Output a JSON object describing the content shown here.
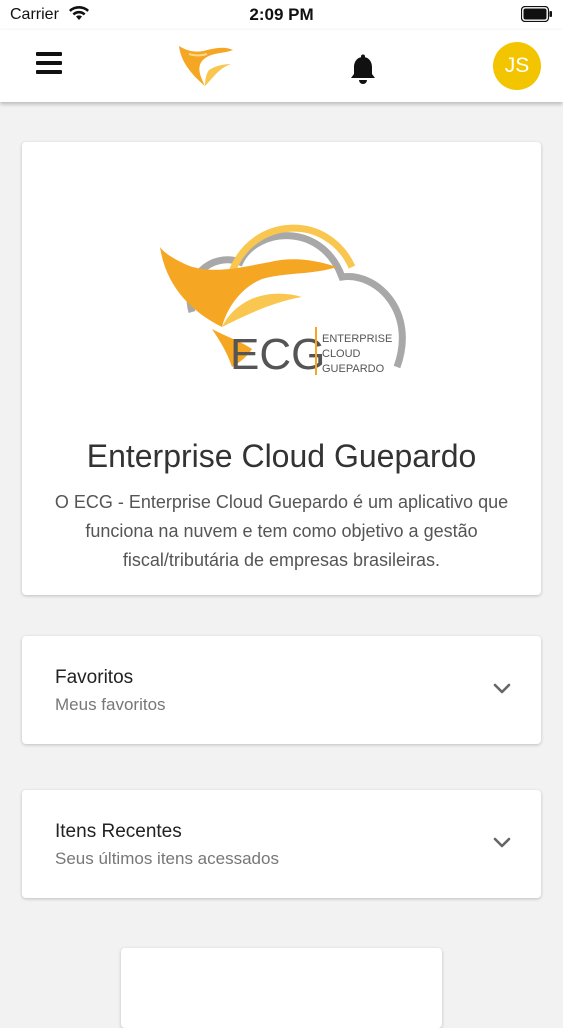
{
  "status_bar": {
    "carrier": "Carrier",
    "time": "2:09 PM"
  },
  "header": {
    "menu_icon": "hamburger-menu-icon",
    "logo_icon": "cheetah-logo-icon",
    "notification_icon": "bell-icon",
    "avatar_initials": "JS",
    "avatar_color": "#f2c500"
  },
  "hero": {
    "logo_text": {
      "abbr": "ECG",
      "line1": "ENTERPRISE",
      "line2": "CLOUD",
      "line3": "GUEPARDO"
    },
    "title": "Enterprise Cloud Guepardo",
    "description": "O ECG - Enterprise Cloud Guepardo é um aplicativo que funciona na nuvem e tem como objetivo a gestão fiscal/tributária de empresas brasileiras."
  },
  "sections": [
    {
      "title": "Favoritos",
      "subtitle": "Meus favoritos",
      "icon": "chevron-down-icon"
    },
    {
      "title": "Itens Recentes",
      "subtitle": "Seus últimos itens acessados",
      "icon": "chevron-down-icon"
    }
  ],
  "colors": {
    "brand_orange": "#f5a623",
    "brand_yellow": "#f9c74f",
    "cloud_gray": "#a8a8a8",
    "background": "#f2f2f2"
  }
}
